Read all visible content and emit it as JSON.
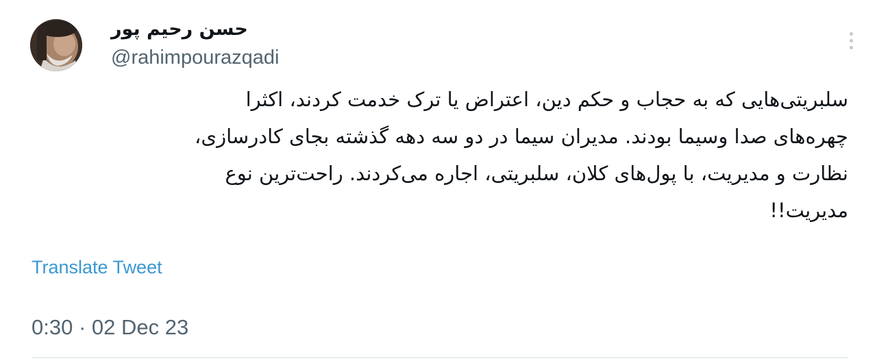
{
  "author": {
    "display_name": "حسن رحیم پور",
    "handle": "@rahimpourazqadi"
  },
  "tweet": {
    "lines": [
      "سلبریتی‌هایی که به حجاب و حکم دین، اعتراض یا ترک خدمت کردند، اکثرا",
      "چهره‌های صدا وسیما بودند. مدیران سیما در دو سه دهه گذشته بجای کادرسازی،",
      "نظارت و مدیریت، با پول‌های کلان، سلبریتی، اجاره می‌کردند. راحت‌ترین نوع",
      "مدیریت!!"
    ],
    "translate_label": "Translate Tweet",
    "timestamp": "0:30 · 02 Dec 23"
  },
  "icons": {
    "more": "more-vertical-icon",
    "avatar": "profile-photo"
  },
  "colors": {
    "link": "#3a98d2",
    "secondary_text": "#536471",
    "primary_text": "#0f1419"
  }
}
